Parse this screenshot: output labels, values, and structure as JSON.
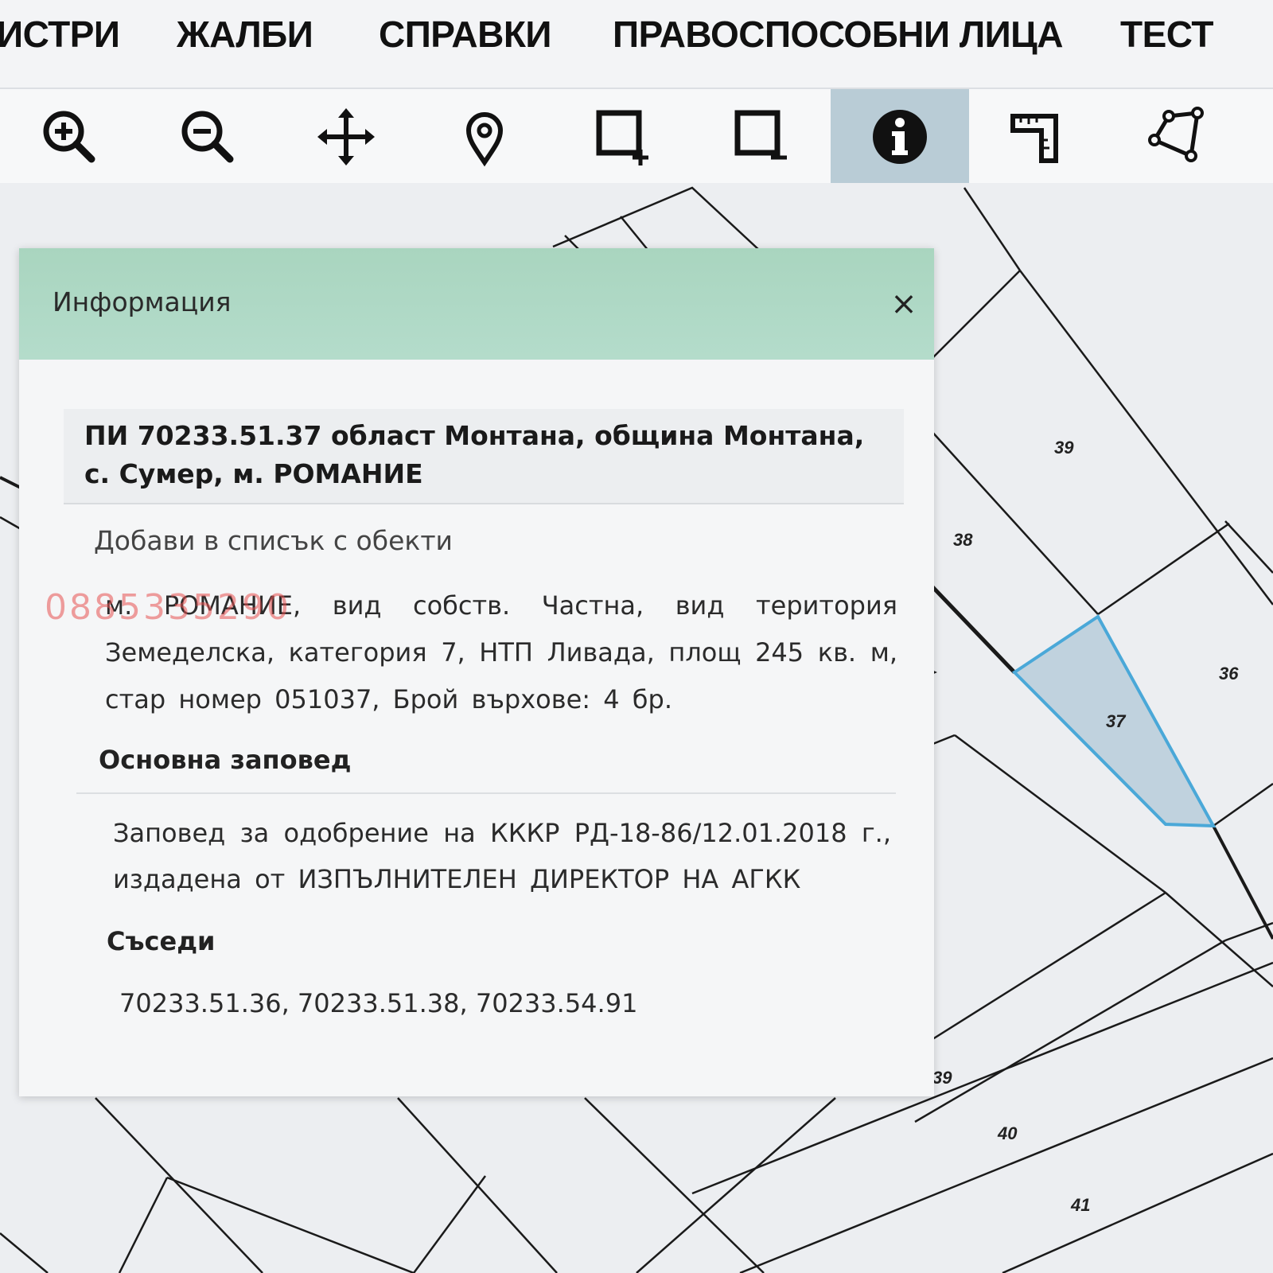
{
  "nav": {
    "items": [
      "ИСТРИ",
      "ЖАЛБИ",
      "СПРАВКИ",
      "ПРАВОСПОСОБНИ ЛИЦА",
      "ТЕСТ"
    ]
  },
  "toolbar": {
    "tools": [
      {
        "icon": "zoom-in-icon"
      },
      {
        "icon": "zoom-out-icon"
      },
      {
        "icon": "pan-icon"
      },
      {
        "icon": "location-pin-icon"
      },
      {
        "icon": "select-area-add-icon"
      },
      {
        "icon": "select-area-remove-icon"
      },
      {
        "icon": "info-icon",
        "active": true
      },
      {
        "icon": "measure-distance-icon"
      },
      {
        "icon": "polygon-icon"
      }
    ],
    "active_color": "#b9ccd6"
  },
  "dialog": {
    "title": "Информация",
    "close_label": "×",
    "header_color": "#b4dccb",
    "parcel_heading_line1": "ПИ 70233.51.37 област Монтана, община Монтана,",
    "parcel_heading_line2": "с. Сумер, м. РОМАНИЕ",
    "add_to_list": "Добави в списък с обекти",
    "details": "м. РОМАНИЕ, вид собств. Частна, вид територия Земеделска, категория 7, НТП Ливада, площ 245 кв. м, стар номер 051037, Брой върхове: 4 бр.",
    "order_heading": "Основна заповед",
    "order_text": "Заповед за одобрение на КККР РД-18-86/12.01.2018 г., издадена от ИЗПЪЛНИТЕЛЕН ДИРЕКТОР НА АГКК",
    "neighbors_heading": "Съседи",
    "neighbors": "70233.51.36, 70233.51.38, 70233.54.91"
  },
  "watermark": {
    "phone": "0885335290"
  },
  "map": {
    "parcel_labels": [
      "39",
      "38",
      "36",
      "37",
      "39",
      "40",
      "41"
    ],
    "highlight_color": "#4aa8d8"
  }
}
